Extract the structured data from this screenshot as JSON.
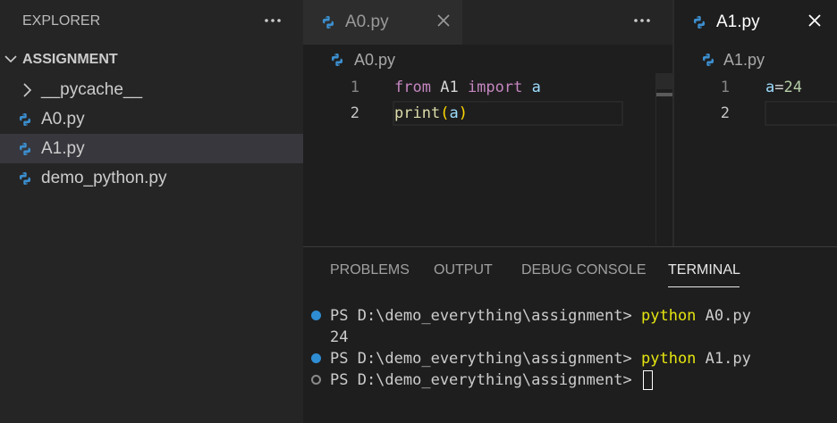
{
  "sidebar": {
    "title": "EXPLORER",
    "section": "ASSIGNMENT",
    "items": [
      {
        "label": "__pycache__",
        "type": "folder"
      },
      {
        "label": "A0.py",
        "type": "python"
      },
      {
        "label": "A1.py",
        "type": "python",
        "selected": true
      },
      {
        "label": "demo_python.py",
        "type": "python"
      }
    ]
  },
  "editor1": {
    "tab": "A0.py",
    "breadcrumb": "A0.py",
    "lines": [
      {
        "num": "1",
        "tokens": [
          "from",
          "A1",
          "import",
          "a"
        ]
      },
      {
        "num": "2",
        "tokens": [
          "print",
          "(",
          "a",
          ")"
        ]
      }
    ]
  },
  "editor2": {
    "tab": "A1.py",
    "breadcrumb": "A1.py",
    "lines": [
      {
        "num": "1",
        "tokens": [
          "a",
          "=",
          "24"
        ]
      },
      {
        "num": "2",
        "tokens": []
      }
    ]
  },
  "panel": {
    "tabs": [
      "PROBLEMS",
      "OUTPUT",
      "DEBUG CONSOLE",
      "TERMINAL"
    ],
    "active_tab": "TERMINAL",
    "terminal": [
      {
        "prompt": "PS D:\\demo_everything\\assignment> ",
        "cmd": "python",
        "args": " A0.py",
        "status": "done"
      },
      {
        "output": "24"
      },
      {
        "prompt": "PS D:\\demo_everything\\assignment> ",
        "cmd": "python",
        "args": " A1.py",
        "status": "done"
      },
      {
        "prompt": "PS D:\\demo_everything\\assignment> ",
        "status": "pending"
      }
    ]
  },
  "icons": {
    "python": "python-file-icon",
    "more": "ellipsis-icon",
    "close": "close-icon",
    "chevron_down": "chevron-down-icon",
    "chevron_right": "chevron-right-icon"
  },
  "colors": {
    "keyword": "#c586c0",
    "function": "#dcdcaa",
    "bracket": "#ffd700",
    "variable": "#9cdcfe",
    "number": "#b5cea8",
    "terminal_command": "#e5e510",
    "status_dot": "#2f8dd4"
  }
}
